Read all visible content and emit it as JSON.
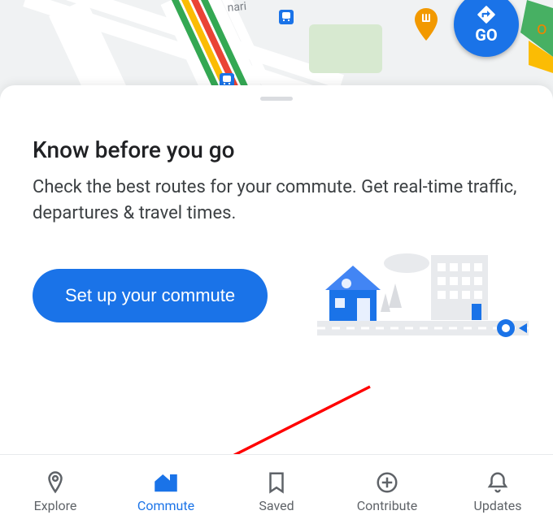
{
  "map": {
    "go_button_label": "GO",
    "partial_label_right": "o"
  },
  "commute_card": {
    "title": "Know before you go",
    "subtitle": "Check the best routes for your commute. Get real-time traffic, departures & travel times.",
    "setup_button_label": "Set up your commute"
  },
  "bottom_nav": {
    "items": [
      {
        "id": "explore",
        "label": "Explore",
        "active": false
      },
      {
        "id": "commute",
        "label": "Commute",
        "active": true
      },
      {
        "id": "saved",
        "label": "Saved",
        "active": false
      },
      {
        "id": "contribute",
        "label": "Contribute",
        "active": false
      },
      {
        "id": "updates",
        "label": "Updates",
        "active": false
      }
    ]
  },
  "colors": {
    "primary": "#1a73e8",
    "text": "#202124",
    "muted": "#5f6368"
  }
}
